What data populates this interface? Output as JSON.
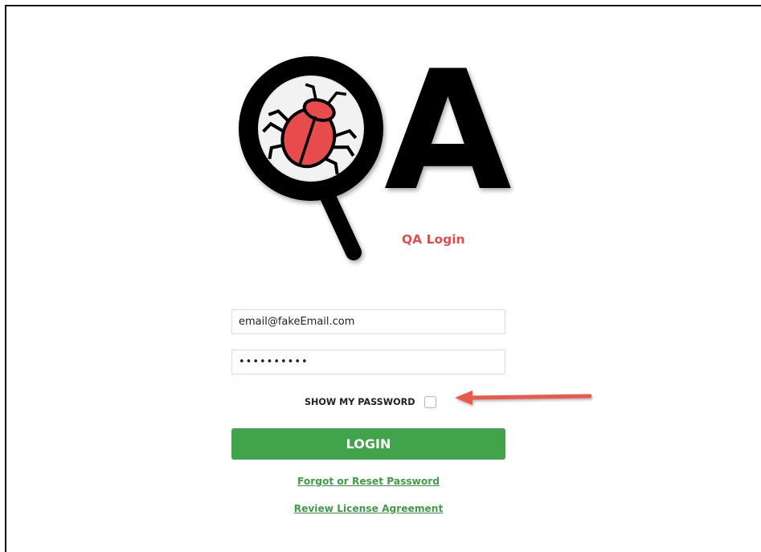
{
  "brand": {
    "logo_icon": "qa-magnifier-bug-logo",
    "logo_letter": "A",
    "title": "QA Login",
    "title_color": "#e84b4b"
  },
  "form": {
    "email_value": "email@fakeEmail.com",
    "password_value": "••••••••••",
    "show_password_label": "SHOW MY PASSWORD",
    "show_password_checked": false,
    "login_label": "LOGIN",
    "button_color": "#41a44a"
  },
  "links": {
    "forgot": "Forgot or Reset Password",
    "license": "Review License Agreement",
    "link_color": "#3f9e45"
  },
  "annotation": {
    "arrow_icon": "red-pointer-arrow",
    "arrow_color": "#ea5a4c"
  }
}
